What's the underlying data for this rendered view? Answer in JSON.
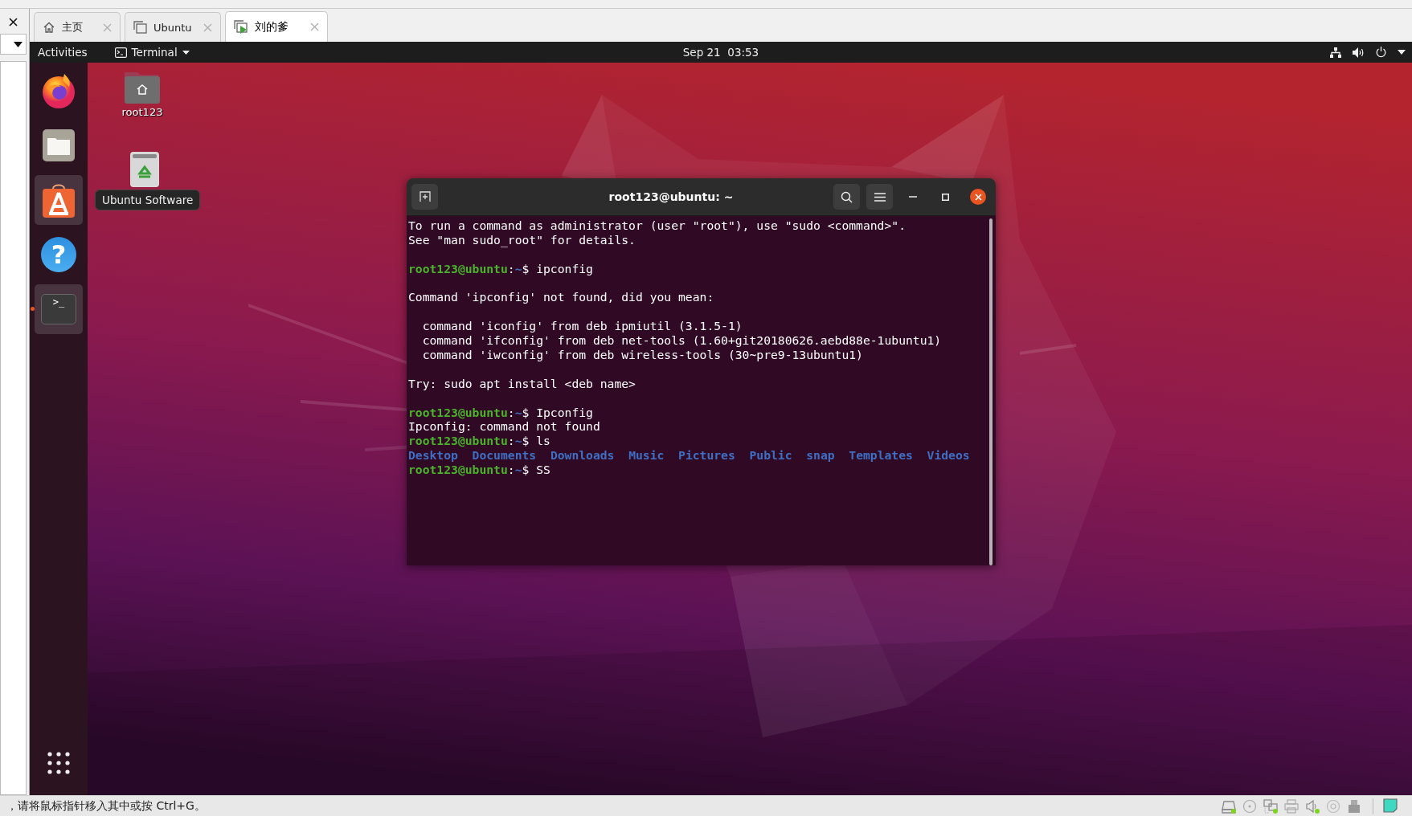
{
  "vm": {
    "tabs": [
      {
        "kind": "home",
        "label": "主页",
        "selected": false
      },
      {
        "kind": "vm",
        "label": "Ubuntu",
        "selected": false
      },
      {
        "kind": "vm-running",
        "label": "刘的爹",
        "selected": true
      }
    ]
  },
  "top_bar": {
    "activities": "Activities",
    "app_menu": "Terminal",
    "clock": "Sep 21  03:53"
  },
  "dock": {
    "items": [
      {
        "kind": "firefox",
        "highlighted": false,
        "running": false
      },
      {
        "kind": "files",
        "highlighted": false,
        "running": false
      },
      {
        "kind": "software",
        "highlighted": true,
        "running": false
      },
      {
        "kind": "help",
        "glyph": "?",
        "highlighted": false,
        "running": false
      },
      {
        "kind": "terminal",
        "glyph": ">_",
        "highlighted": true,
        "running": true
      }
    ]
  },
  "desktop": {
    "icons": [
      {
        "kind": "folder",
        "label": "root123"
      },
      {
        "kind": "trash"
      }
    ],
    "tooltip": "Ubuntu Software"
  },
  "terminal": {
    "title": "root123@ubuntu: ~",
    "lines": [
      {
        "kind": "output",
        "text": "To run a command as administrator (user \"root\"), use \"sudo <command>\"."
      },
      {
        "kind": "output",
        "text": "See \"man sudo_root\" for details."
      },
      {
        "kind": "blank"
      },
      {
        "kind": "prompt",
        "host": "root123@ubuntu",
        "sep": ":",
        "path": "~",
        "input": "$ ipconfig"
      },
      {
        "kind": "blank"
      },
      {
        "kind": "output",
        "text": "Command 'ipconfig' not found, did you mean:"
      },
      {
        "kind": "blank"
      },
      {
        "kind": "output",
        "text": "  command 'iconfig' from deb ipmiutil (3.1.5-1)"
      },
      {
        "kind": "output",
        "text": "  command 'ifconfig' from deb net-tools (1.60+git20180626.aebd88e-1ubuntu1)"
      },
      {
        "kind": "output",
        "text": "  command 'iwconfig' from deb wireless-tools (30~pre9-13ubuntu1)"
      },
      {
        "kind": "blank"
      },
      {
        "kind": "output",
        "text": "Try: sudo apt install <deb name>"
      },
      {
        "kind": "blank"
      },
      {
        "kind": "prompt",
        "host": "root123@ubuntu",
        "sep": ":",
        "path": "~",
        "input": "$ Ipconfig"
      },
      {
        "kind": "output",
        "text": "Ipconfig: command not found"
      },
      {
        "kind": "prompt",
        "host": "root123@ubuntu",
        "sep": ":",
        "path": "~",
        "input": "$ ls"
      },
      {
        "kind": "dirs",
        "items": [
          "Desktop",
          "Documents",
          "Downloads",
          "Music",
          "Pictures",
          "Public",
          "snap",
          "Templates",
          "Videos"
        ]
      },
      {
        "kind": "prompt",
        "host": "root123@ubuntu",
        "sep": ":",
        "path": "~",
        "input": "$ SS"
      }
    ]
  },
  "status_bar": {
    "message": "，请将鼠标指针移入其中或按 Ctrl+G。",
    "devices": [
      {
        "kind": "disk",
        "active": true
      },
      {
        "kind": "cd",
        "active": false
      },
      {
        "kind": "network",
        "active": true
      },
      {
        "kind": "printer",
        "active": false
      },
      {
        "kind": "sound",
        "active": true
      },
      {
        "kind": "camera",
        "active": false
      },
      {
        "kind": "usb",
        "active": false
      },
      {
        "kind": "note",
        "active": false
      }
    ]
  }
}
